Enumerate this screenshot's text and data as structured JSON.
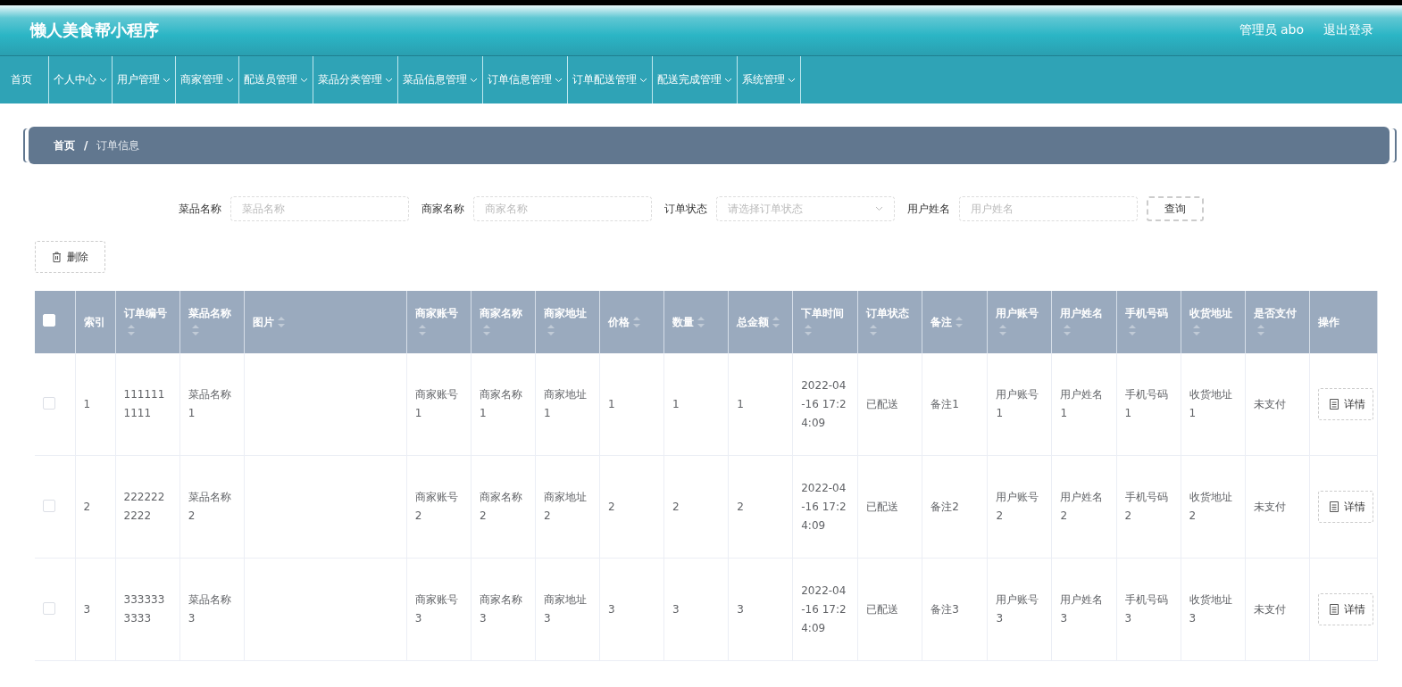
{
  "header": {
    "title": "懒人美食帮小程序",
    "user": "管理员 abo",
    "logout": "退出登录"
  },
  "nav": [
    {
      "label": "首页",
      "has_menu": false
    },
    {
      "label": "个人中心",
      "has_menu": true
    },
    {
      "label": "用户管理",
      "has_menu": true
    },
    {
      "label": "商家管理",
      "has_menu": true
    },
    {
      "label": "配送员管理",
      "has_menu": true
    },
    {
      "label": "菜品分类管理",
      "has_menu": true
    },
    {
      "label": "菜品信息管理",
      "has_menu": true
    },
    {
      "label": "订单信息管理",
      "has_menu": true
    },
    {
      "label": "订单配送管理",
      "has_menu": true
    },
    {
      "label": "配送完成管理",
      "has_menu": true
    },
    {
      "label": "系统管理",
      "has_menu": true
    }
  ],
  "breadcrumb": {
    "items": [
      "首页",
      "订单信息"
    ],
    "separator": "/"
  },
  "filters": [
    {
      "label": "菜品名称",
      "kind": "input",
      "placeholder": "菜品名称"
    },
    {
      "label": "商家名称",
      "kind": "input",
      "placeholder": "商家名称"
    },
    {
      "label": "订单状态",
      "kind": "select",
      "placeholder": "请选择订单状态"
    },
    {
      "label": "用户姓名",
      "kind": "input",
      "placeholder": "用户姓名"
    }
  ],
  "search_button": "查询",
  "delete_button": "删除",
  "table": {
    "header_checked": false,
    "columns": [
      {
        "label": "索引",
        "sortable": false
      },
      {
        "label": "订单编号",
        "sortable": true
      },
      {
        "label": "菜品名称",
        "sortable": true
      },
      {
        "label": "图片",
        "sortable": true
      },
      {
        "label": "商家账号",
        "sortable": true
      },
      {
        "label": "商家名称",
        "sortable": true
      },
      {
        "label": "商家地址",
        "sortable": true
      },
      {
        "label": "价格",
        "sortable": true
      },
      {
        "label": "数量",
        "sortable": true
      },
      {
        "label": "总金额",
        "sortable": true
      },
      {
        "label": "下单时间",
        "sortable": true
      },
      {
        "label": "订单状态",
        "sortable": true
      },
      {
        "label": "备注",
        "sortable": true
      },
      {
        "label": "用户账号",
        "sortable": true
      },
      {
        "label": "用户姓名",
        "sortable": true
      },
      {
        "label": "手机号码",
        "sortable": true
      },
      {
        "label": "收货地址",
        "sortable": true
      },
      {
        "label": "是否支付",
        "sortable": true
      },
      {
        "label": "操作",
        "sortable": false
      }
    ],
    "rows": [
      {
        "checked": false,
        "cells": [
          "1",
          "1111111111",
          "菜品名称1",
          "",
          "商家账号1",
          "商家名称1",
          "商家地址1",
          "1",
          "1",
          "1",
          "2022-04-16 17:24:09",
          "已配送",
          "备注1",
          "用户账号1",
          "用户姓名1",
          "手机号码1",
          "收货地址1",
          "未支付"
        ],
        "action": "详情"
      },
      {
        "checked": false,
        "cells": [
          "2",
          "2222222222",
          "菜品名称2",
          "",
          "商家账号2",
          "商家名称2",
          "商家地址2",
          "2",
          "2",
          "2",
          "2022-04-16 17:24:09",
          "已配送",
          "备注2",
          "用户账号2",
          "用户姓名2",
          "手机号码2",
          "收货地址2",
          "未支付"
        ],
        "action": "详情"
      },
      {
        "checked": false,
        "cells": [
          "3",
          "3333333333",
          "菜品名称3",
          "",
          "商家账号3",
          "商家名称3",
          "商家地址3",
          "3",
          "3",
          "3",
          "2022-04-16 17:24:09",
          "已配送",
          "备注3",
          "用户账号3",
          "用户姓名3",
          "手机号码3",
          "收货地址3",
          "未支付"
        ],
        "action": "详情"
      }
    ]
  }
}
